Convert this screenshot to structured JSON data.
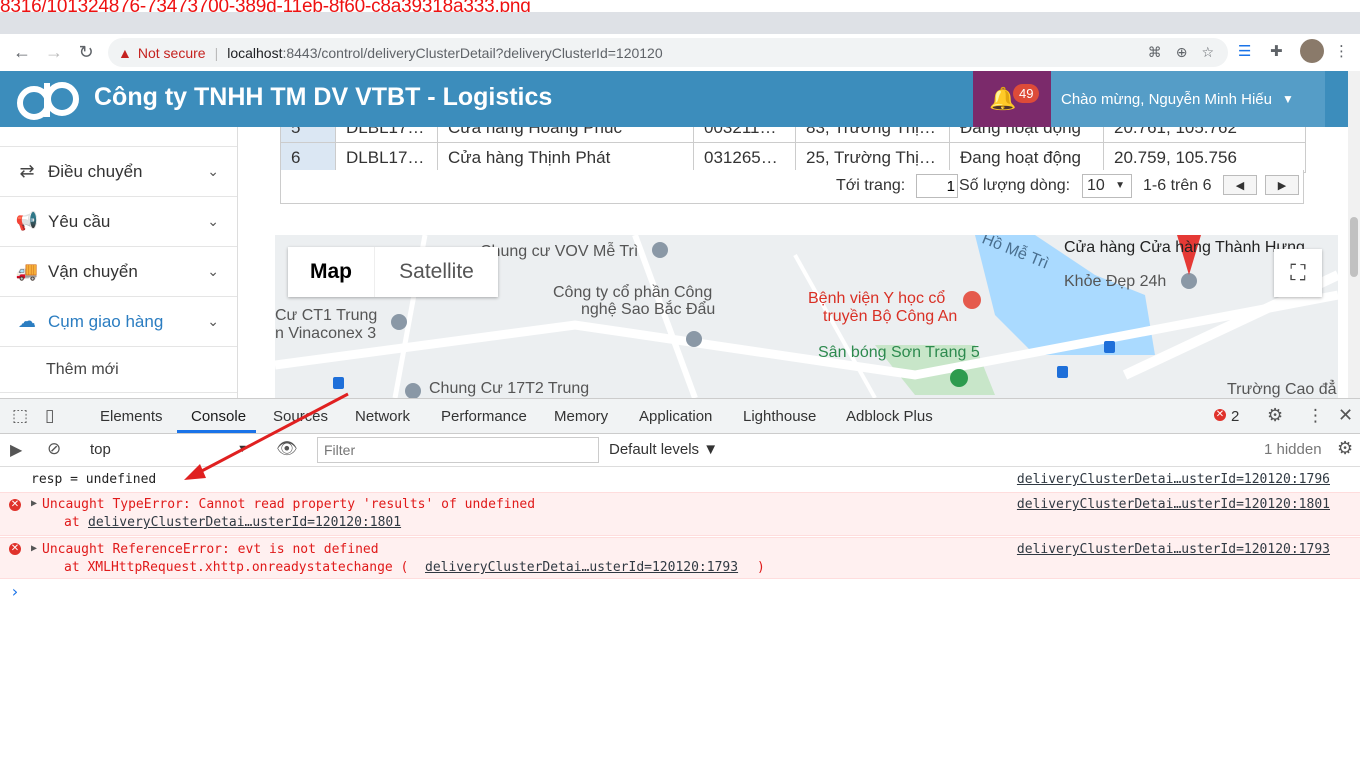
{
  "filename": "8316/101324876-73473700-389d-11eb-8f60-c8a39318a333.png",
  "browser": {
    "security": "Not secure",
    "url_host": "localhost",
    "url_path": ":8443/control/deliveryClusterDetail?deliveryClusterId=120120"
  },
  "app": {
    "brand": "Công ty TNHH TM DV VTBT - Logistics",
    "notif_count": "49",
    "greeting": "Chào mừng, Nguyễn Minh Hiếu"
  },
  "sidebar": {
    "items": [
      {
        "label": "Điều chuyển",
        "icon": "exchange-icon"
      },
      {
        "label": "Yêu cầu",
        "icon": "megaphone-icon"
      },
      {
        "label": "Vận chuyển",
        "icon": "truck-icon"
      },
      {
        "label": "Cụm giao hàng",
        "icon": "cloud-icon"
      }
    ],
    "sub": "Thêm mới"
  },
  "table": {
    "rows": [
      [
        "5",
        "DLBL17…",
        "Cửa hàng Hoàng Phúc",
        "003211…",
        "83, Trường Thị…",
        "Đang hoạt động",
        "20.761, 105.762"
      ],
      [
        "6",
        "DLBL17…",
        "Cửa hàng Thịnh Phát",
        "031265…",
        "25, Trường Thị…",
        "Đang hoạt động",
        "20.759, 105.756"
      ]
    ]
  },
  "pager": {
    "goto_label": "Tới trang:",
    "goto_value": "1",
    "rows_label": "Số lượng dòng:",
    "rows_value": "10",
    "range": "1-6 trên 6"
  },
  "map": {
    "map_btn": "Map",
    "satellite_btn": "Satellite",
    "labels": {
      "vov": "Chung cư VOV Mễ Trì",
      "company1": "Công ty cổ phần Công",
      "company2": "nghệ Sao Bắc Đẩu",
      "ct1a": "Cư CT1 Trung",
      "ct1b": "n Vinaconex 3",
      "hospital1": "Bệnh viện Y học cổ",
      "hospital2": "truyền Bộ Công An",
      "lake": "Hồ Mễ Trì",
      "store": "Cửa hàng Cửa hàng Thành Hưng",
      "beauty": "Khỏe Đẹp 24h",
      "stadium": "Sân bóng Sơn Trang 5",
      "ct17": "Chung Cư 17T2 Trung",
      "school": "Trường Cao đẳ"
    }
  },
  "devtools": {
    "tabs": [
      "Elements",
      "Console",
      "Sources",
      "Network",
      "Performance",
      "Memory",
      "Application",
      "Lighthouse",
      "Adblock Plus"
    ],
    "error_count": "2",
    "context": "top",
    "filter_placeholder": "Filter",
    "levels": "Default levels ▼",
    "hidden": "1 hidden"
  },
  "console": {
    "log1": "resp = undefined",
    "log1_src": "deliveryClusterDetai…usterId=120120:1796",
    "err1": "Uncaught TypeError: Cannot read property 'results' of undefined",
    "err1_at": "at ",
    "err1_link": "deliveryClusterDetai…usterId=120120:1801",
    "err1_src": "deliveryClusterDetai…usterId=120120:1801",
    "err2": "Uncaught ReferenceError: evt is not defined",
    "err2_at": "at XMLHttpRequest.xhttp.onreadystatechange (",
    "err2_link": "deliveryClusterDetai…usterId=120120:1793",
    "err2_close": ")",
    "err2_src": "deliveryClusterDetai…usterId=120120:1793",
    "prompt": "›"
  },
  "colors": {
    "header": "#3c8dbc",
    "notif_bg": "#7b2a6b",
    "annotation_arrow": "#e02020"
  }
}
